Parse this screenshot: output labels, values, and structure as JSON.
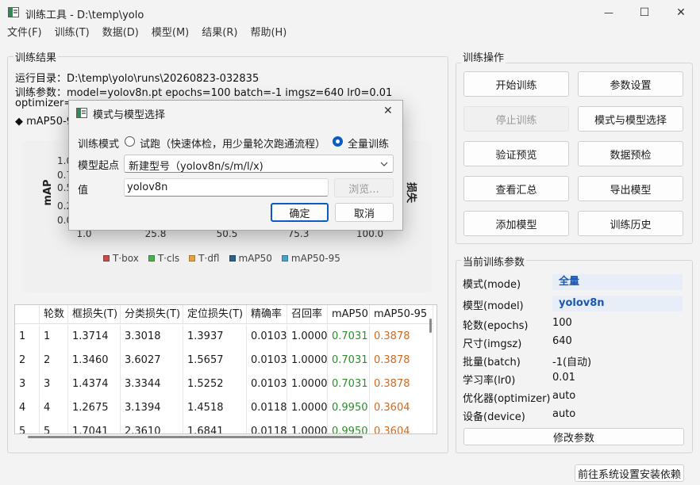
{
  "window": {
    "title": "训练工具 - D:\\temp\\yolo",
    "minimize_glyph": "—",
    "maximize_glyph": "☐",
    "close_glyph": "✕"
  },
  "menu": [
    "文件(F)",
    "训练(T)",
    "数据(D)",
    "模型(M)",
    "结果(R)",
    "帮助(H)"
  ],
  "results": {
    "group_title": "训练结果",
    "run_dir": "运行目录：D:\\temp\\yolo\\runs\\20260823-032835",
    "params": "训练参数：model=yolov8n.pt  epochs=100  batch=-1  imgsz=640  lr0=0.01",
    "optimizer_fragment": "optimizer=",
    "metric_fragment": "◆ mAP50-9"
  },
  "chart_data": {
    "type": "line",
    "ylabel": "mAP",
    "y2label": "损失",
    "ytick_labels": [
      "0.0",
      "0.2",
      "0.5",
      "0.7",
      "1.0"
    ],
    "xtick_labels": [
      "1.0",
      "25.8",
      "50.5",
      "75.3",
      "100.0"
    ],
    "xlim": [
      1,
      100
    ],
    "legend_position": "bottom",
    "series": [
      {
        "name": "T·box",
        "color": "#c0504d"
      },
      {
        "name": "T·cls",
        "color": "#4caf50"
      },
      {
        "name": "T·dfl",
        "color": "#e6a23c"
      },
      {
        "name": "mAP50",
        "color": "#2f5f8f"
      },
      {
        "name": "mAP50-95",
        "color": "#4aa3c8"
      }
    ]
  },
  "table": {
    "headers": [
      "轮数",
      "框损失(T)",
      "分类损失(T)",
      "定位损失(T)",
      "精确率",
      "召回率",
      "mAP50",
      "mAP50-95"
    ],
    "rows": [
      {
        "idx": "1",
        "cells": [
          "1",
          "1.3714",
          "3.3018",
          "1.3937",
          "0.0103",
          "1.0000",
          "0.7031",
          "0.3878"
        ]
      },
      {
        "idx": "2",
        "cells": [
          "2",
          "1.3460",
          "3.6027",
          "1.5657",
          "0.0103",
          "1.0000",
          "0.7031",
          "0.3878"
        ]
      },
      {
        "idx": "3",
        "cells": [
          "3",
          "1.4374",
          "3.3344",
          "1.5252",
          "0.0103",
          "1.0000",
          "0.7031",
          "0.3878"
        ]
      },
      {
        "idx": "4",
        "cells": [
          "4",
          "1.2675",
          "3.1394",
          "1.4518",
          "0.0118",
          "1.0000",
          "0.9950",
          "0.3604"
        ]
      },
      {
        "idx": "5",
        "cells": [
          "5",
          "1.7041",
          "2.3610",
          "1.6841",
          "0.0118",
          "1.0000",
          "0.9950",
          "0.3604"
        ]
      }
    ]
  },
  "ops": {
    "group_title": "训练操作",
    "buttons": [
      "开始训练",
      "参数设置",
      "停止训练",
      "模式与模型选择",
      "验证预览",
      "数据预检",
      "查看汇总",
      "导出模型",
      "添加模型",
      "训练历史"
    ]
  },
  "current": {
    "group_title": "当前训练参数",
    "rows": [
      {
        "label": "模式(mode)",
        "value": "全量"
      },
      {
        "label": "模型(model)",
        "value": "yolov8n"
      },
      {
        "label": "轮数(epochs)",
        "value": "100"
      },
      {
        "label": "尺寸(imgsz)",
        "value": "640"
      },
      {
        "label": "批量(batch)",
        "value": "-1(自动)"
      },
      {
        "label": "学习率(lr0)",
        "value": "0.01"
      },
      {
        "label": "优化器(optimizer)",
        "value": "auto"
      },
      {
        "label": "设备(device)",
        "value": "auto"
      }
    ],
    "modify_button": "修改参数"
  },
  "footer_button": "前往系统设置安装依赖",
  "dialog": {
    "title": "模式与模型选择",
    "mode_label": "训练模式",
    "radio_trial": "试跑（快速体检，用少量轮次跑通流程）",
    "radio_full": "全量训练",
    "model_source_label": "模型起点",
    "model_source_value": "新建型号（yolov8n/s/m/l/x)",
    "value_label": "值",
    "value_input": "yolov8n",
    "browse": "浏览...",
    "ok": "确定",
    "cancel": "取消",
    "close_glyph": "✕"
  }
}
